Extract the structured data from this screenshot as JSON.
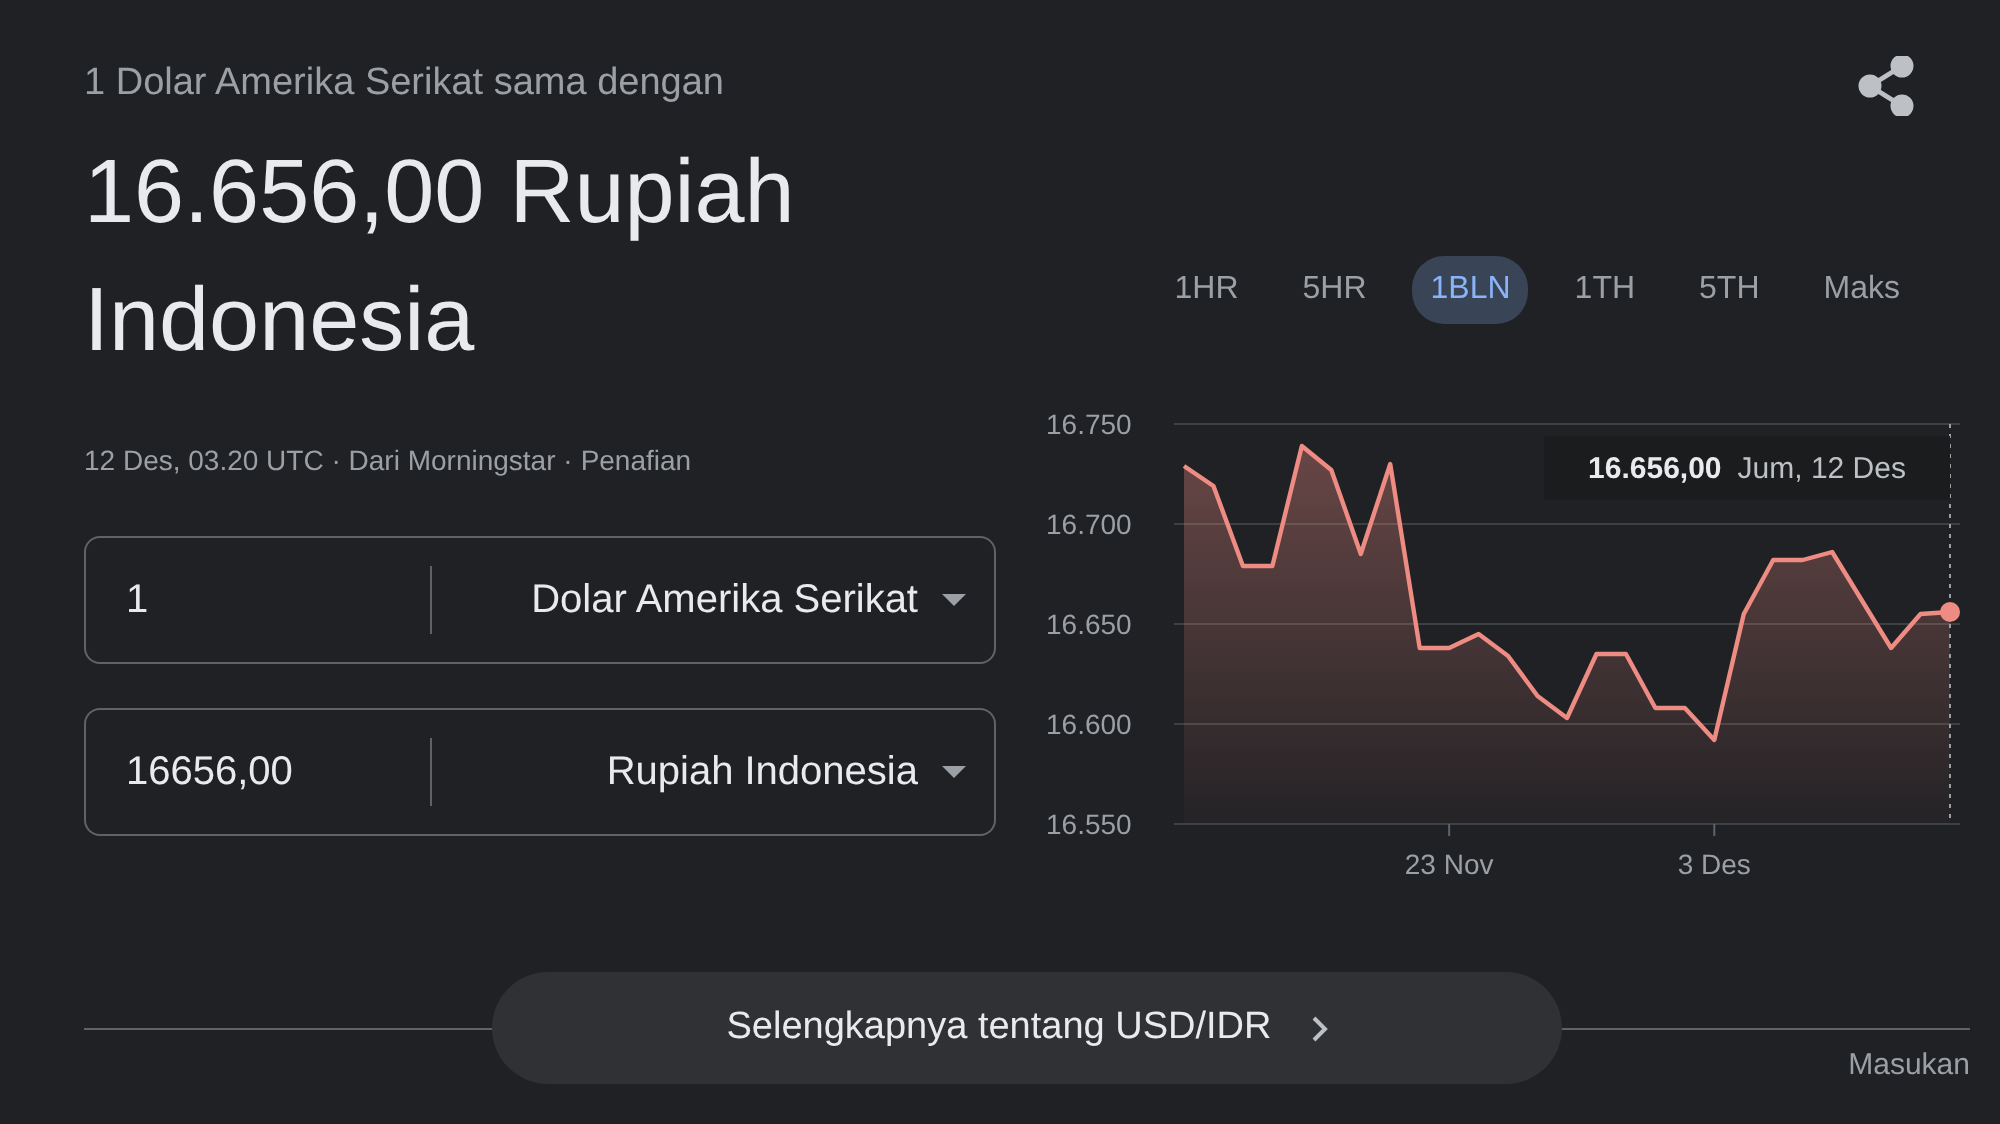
{
  "header": {
    "subtitle": "1 Dolar Amerika Serikat sama dengan",
    "result": "16.656,00 Rupiah Indonesia",
    "meta": "12 Des, 03.20 UTC · Dari Morningstar ·",
    "disclaimer": "Penafian"
  },
  "converter": [
    {
      "amount": "1",
      "currency": "Dolar Amerika Serikat"
    },
    {
      "amount": "16656,00",
      "currency": "Rupiah Indonesia"
    }
  ],
  "ranges": [
    {
      "label": "1HR",
      "selected": false
    },
    {
      "label": "5HR",
      "selected": false
    },
    {
      "label": "1BLN",
      "selected": true
    },
    {
      "label": "1TH",
      "selected": false
    },
    {
      "label": "5TH",
      "selected": false
    },
    {
      "label": "Maks",
      "selected": false
    }
  ],
  "chart": {
    "tooltip": {
      "value": "16.656,00",
      "date": "Jum, 12 Des"
    },
    "chart_data": {
      "type": "area",
      "grid": true,
      "categories": [
        null,
        null,
        null,
        null,
        null,
        null,
        null,
        null,
        null,
        "23 Nov",
        null,
        null,
        null,
        null,
        null,
        null,
        null,
        null,
        "3 Des",
        null,
        null,
        null,
        null,
        null,
        null,
        null,
        null
      ],
      "series": [
        {
          "color": "#ee8c83",
          "values": [
            16729,
            16719,
            16679,
            16679,
            16739,
            16727,
            16685,
            16730,
            16638,
            16638,
            16645,
            16634,
            16614,
            16603,
            16635,
            16635,
            16608,
            16608,
            16592,
            16655,
            16682,
            16682,
            16686,
            16662,
            16638,
            16655,
            16656
          ]
        }
      ],
      "ylim": [
        16550,
        16750
      ],
      "yticks": [
        {
          "value": 16750,
          "label": "16.750"
        },
        {
          "value": 16700,
          "label": "16.700"
        },
        {
          "value": 16650,
          "label": "16.650"
        },
        {
          "value": 16600,
          "label": "16.600"
        },
        {
          "value": 16550,
          "label": "16.550"
        }
      ]
    }
  },
  "more_button": {
    "label": "Selengkapnya tentang USD/IDR"
  },
  "feedback": "Masukan"
}
